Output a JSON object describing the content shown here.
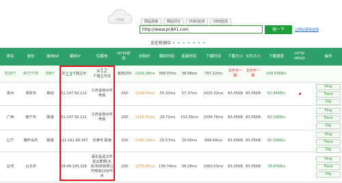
{
  "top_tabs": [
    "网站测速",
    "网站评分",
    "PING检测",
    "DNS检测"
  ],
  "url_value": "http://www.pc841.com",
  "go_button": "测一下",
  "side_link": "让网站更快选择",
  "progress_text": "正在检测中",
  "progress_dots": "• • • • • • •",
  "headers": {
    "order": "排名",
    "province": "省份",
    "city": "城市",
    "isp": "ISP",
    "ip": "解析IP",
    "location": "归属地",
    "http_status": "HTTP状态",
    "total_time": "总耗时",
    "resolve_time": "解析时间",
    "connect_time": "连接时间",
    "download_time": "下载时间",
    "download_size": "下载大小",
    "file_size": "文件大小",
    "download_speed": "下载速度",
    "http_head": "HTTP HEAD",
    "action": "操作"
  },
  "summary": {
    "provinces": "共25个",
    "cities": "共77个市",
    "isps": "共8个",
    "ips_prefix": "共",
    "ips_count": "13",
    "ips_suffix": "个独立IP",
    "nodes_prefix": "共",
    "nodes_count": "12",
    "nodes_suffix": "个独立节点",
    "status": "有效200",
    "total": "1103.28ms",
    "resolve": "358.07ms",
    "connect": "38.08ms",
    "download": "707.12ms",
    "dl_size": "文件不一致",
    "file_size": "文件不一致",
    "speed": "209.43KB/s"
  },
  "rows": [
    {
      "province": "贵州",
      "city": "贵阳市",
      "isp": "移动",
      "ip": "61.147.92.111",
      "location": "江苏省扬州市 电信",
      "status": "200",
      "total": "1138.01ms",
      "resolve": "55.32ms",
      "connect": "57.37ms",
      "download": "1025.32ms",
      "dl_size": "83.05KB",
      "file_size": "83.05KB",
      "speed": "82.94KB/s"
    },
    {
      "province": "广西",
      "city": "南宁市",
      "isp": "联通",
      "ip": "61.147.92.111",
      "location": "江苏省扬州市 电信",
      "status": "200",
      "total": "1216.52ms",
      "resolve": "29.72ms",
      "connect": "152.05ms",
      "download": "1034.76ms",
      "dl_size": "83.05KB",
      "file_size": "83.05KB",
      "speed": "82.19KB/s"
    },
    {
      "province": "辽宁",
      "city": "葫芦岛市",
      "isp": "联通",
      "ip": "111.161.66.167",
      "location": "天津市 联通",
      "status": "200",
      "total": "1040.13ms",
      "resolve": "20.57ms",
      "connect": "20.06ms",
      "download": "999.49ms",
      "dl_size": "83.05KB",
      "file_size": "83.05KB",
      "speed": "85.09KB/s"
    },
    {
      "province": "台湾",
      "city": "台北市",
      "isp": "",
      "ip": "58.49.105.226",
      "location": "湖北省武汉市 星云数据(北京)科技有限公司电信CDN节点",
      "status": "200",
      "total": "1275.05ms",
      "resolve": "156.74ms",
      "connect": "36.28ms",
      "download": "1082.03ms",
      "dl_size": "83.05KB",
      "file_size": "83.05KB",
      "speed": "78.60KB/s"
    }
  ],
  "action_buttons": [
    "Ping",
    "Trace",
    "Dig"
  ]
}
